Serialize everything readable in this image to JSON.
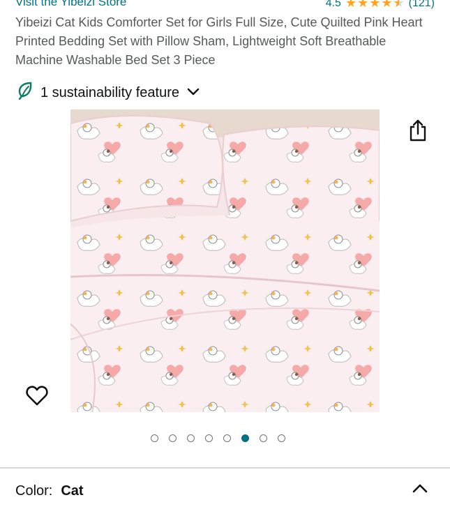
{
  "header": {
    "store_link": "Visit the Yibeizi Store",
    "rating": "4.5",
    "stars_value": 4.5,
    "rating_count": "(121)"
  },
  "product": {
    "title": "Yibeizi Cat Kids Comforter Set for Girls Full Size, Cute Quilted Pink Heart Printed Bedding Set with Pillow Sham, Lightweight Soft Breathable Machine Washable Bed Set 3 Piece"
  },
  "sustainability": {
    "label": "1 sustainability feature"
  },
  "gallery": {
    "image_count": 8,
    "active_index": 5
  },
  "variation": {
    "label": "Color:",
    "value": "Cat"
  },
  "colors": {
    "link": "#007185",
    "star": "#ffa41c",
    "leaf": "#067d62",
    "active_dot": "#007185"
  }
}
